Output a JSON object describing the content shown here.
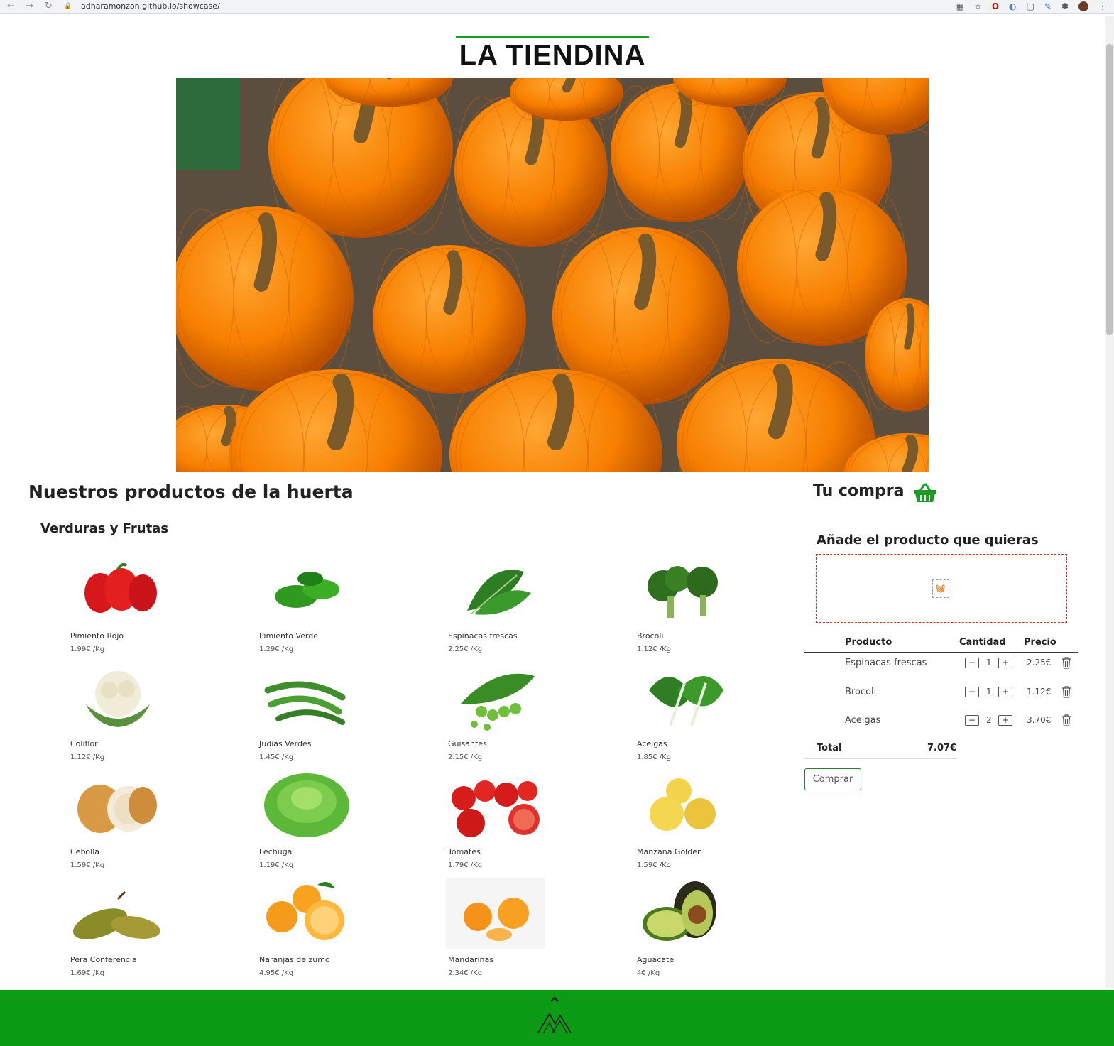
{
  "browser": {
    "url": "adharamonzon.github.io/showcase/"
  },
  "header": {
    "title": "LA TIENDINA"
  },
  "products_section": {
    "title": "Nuestros productos de la huerta",
    "category": "Verduras y Frutas",
    "items": [
      {
        "name": "Pimiento Rojo",
        "price": "1.99€ /Kg",
        "icon": "red-pepper"
      },
      {
        "name": "Pimiento Verde",
        "price": "1.29€ /Kg",
        "icon": "green-pepper"
      },
      {
        "name": "Espinacas frescas",
        "price": "2.25€ /Kg",
        "icon": "spinach"
      },
      {
        "name": "Brocoli",
        "price": "1.12€ /Kg",
        "icon": "broccoli"
      },
      {
        "name": "Coliflor",
        "price": "1.12€ /Kg",
        "icon": "cauliflower"
      },
      {
        "name": "Judias Verdes",
        "price": "1.45€ /Kg",
        "icon": "green-beans"
      },
      {
        "name": "Guisantes",
        "price": "2.15€ /Kg",
        "icon": "peas"
      },
      {
        "name": "Acelgas",
        "price": "1.85€ /Kg",
        "icon": "chard"
      },
      {
        "name": "Cebolla",
        "price": "1.59€ /Kg",
        "icon": "onion"
      },
      {
        "name": "Lechuga",
        "price": "1.19€ /Kg",
        "icon": "lettuce"
      },
      {
        "name": "Tomates",
        "price": "1.79€ /Kg",
        "icon": "tomatoes"
      },
      {
        "name": "Manzana Golden",
        "price": "1.59€ /Kg",
        "icon": "apples"
      },
      {
        "name": "Pera Conferencia",
        "price": "1.69€ /Kg",
        "icon": "pears"
      },
      {
        "name": "Naranjas de zumo",
        "price": "4.95€ /Kg",
        "icon": "oranges"
      },
      {
        "name": "Mandarinas",
        "price": "2.34€ /Kg",
        "icon": "mandarins"
      },
      {
        "name": "Aguacate",
        "price": "4€ /Kg",
        "icon": "avocado"
      }
    ]
  },
  "cart": {
    "title": "Tu compra",
    "add_prompt": "Añade el producto que quieras",
    "headers": {
      "product": "Producto",
      "quantity": "Cantidad",
      "price": "Precio"
    },
    "rows": [
      {
        "product": "Espinacas frescas",
        "qty": "1",
        "price": "2.25€"
      },
      {
        "product": "Brocoli",
        "qty": "1",
        "price": "1.12€"
      },
      {
        "product": "Acelgas",
        "qty": "2",
        "price": "3.70€"
      }
    ],
    "total_label": "Total",
    "total_value": "7.07€",
    "buy_label": "Comprar"
  },
  "colors": {
    "accent": "#1a9c22",
    "footer": "#0c9b14",
    "dropzone_border": "#c0392b"
  }
}
